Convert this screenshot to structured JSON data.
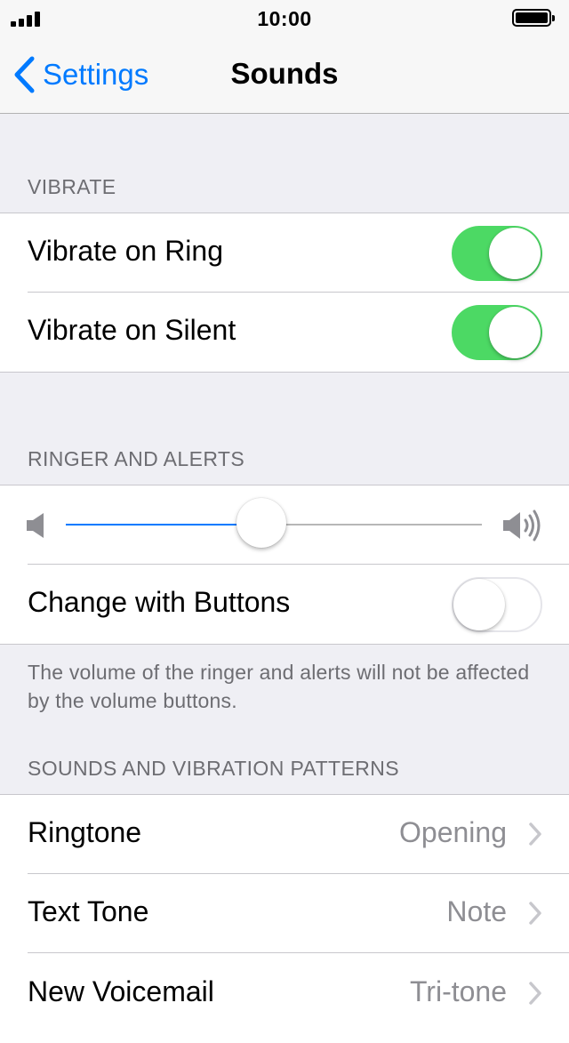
{
  "status_bar": {
    "time": "10:00",
    "signal_icon": "cellular-signal-icon",
    "battery_icon": "battery-full-icon"
  },
  "nav": {
    "back_label": "Settings",
    "title": "Sounds"
  },
  "vibrate": {
    "header": "VIBRATE",
    "rows": [
      {
        "label": "Vibrate on Ring",
        "on": true
      },
      {
        "label": "Vibrate on Silent",
        "on": true
      }
    ]
  },
  "ringer": {
    "header": "RINGER AND ALERTS",
    "volume_level": 0.47,
    "change_with_buttons_label": "Change with Buttons",
    "change_with_buttons_on": false,
    "footer": "The volume of the ringer and alerts will not be affected by the volume buttons."
  },
  "sounds": {
    "header": "SOUNDS AND VIBRATION PATTERNS",
    "rows": [
      {
        "label": "Ringtone",
        "value": "Opening"
      },
      {
        "label": "Text Tone",
        "value": "Note"
      },
      {
        "label": "New Voicemail",
        "value": "Tri-tone"
      }
    ]
  },
  "colors": {
    "accent": "#007aff",
    "toggle_on": "#4cd964",
    "background": "#efeff4",
    "secondary_text": "#8e8e93"
  }
}
